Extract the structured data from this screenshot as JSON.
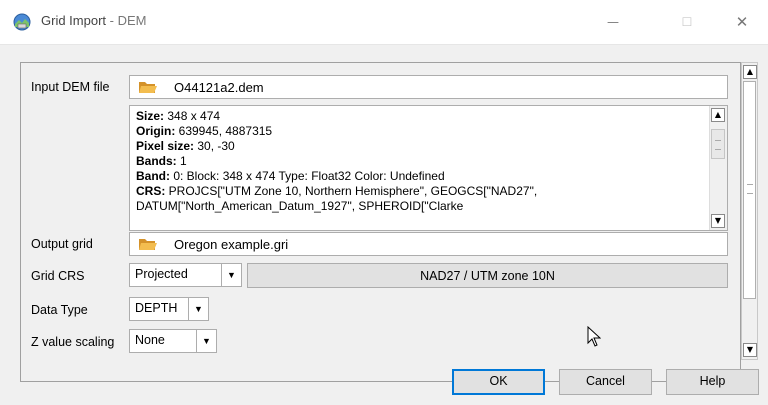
{
  "window": {
    "title_main": "Grid Import",
    "title_sep": " - ",
    "title_sub": "DEM",
    "minimize_glyph": "—",
    "maximize_glyph": "☐",
    "close_glyph": "✕"
  },
  "form": {
    "input_dem_label": "Input DEM file",
    "input_dem_value": "O44121a2.dem",
    "info": {
      "size_label": "Size:",
      "size_value": " 348 x 474",
      "origin_label": "Origin:",
      "origin_value": " 639945, 4887315",
      "pixel_label": "Pixel size:",
      "pixel_value": " 30, -30",
      "bands_label": "Bands:",
      "bands_value": " 1",
      "band_label": "Band:",
      "band_value": " 0: Block: 348 x 474 Type: Float32 Color: Undefined",
      "crs_label": "CRS:",
      "crs_value": " PROJCS[\"UTM Zone 10, Northern Hemisphere\", GEOGCS[\"NAD27\",",
      "crs_value_2": "DATUM[\"North_American_Datum_1927\", SPHEROID[\"Clarke"
    },
    "output_grid_label": "Output grid",
    "output_grid_value": "Oregon example.gri",
    "grid_crs_label": "Grid CRS",
    "grid_crs_selected": "Projected",
    "crs_button_label": "NAD27 / UTM zone 10N",
    "data_type_label": "Data Type",
    "data_type_selected": "DEPTH",
    "z_scaling_label": "Z value scaling",
    "z_scaling_selected": "None"
  },
  "footer": {
    "ok_label": "OK",
    "cancel_label": "Cancel",
    "help_label": "Help"
  },
  "icons": {
    "app": "grid-import-app-icon",
    "folder": "folder-open-icon",
    "arrow": "▼",
    "up": "▲"
  },
  "colors": {
    "folder": "#e6a533",
    "accent": "#0078d7"
  }
}
